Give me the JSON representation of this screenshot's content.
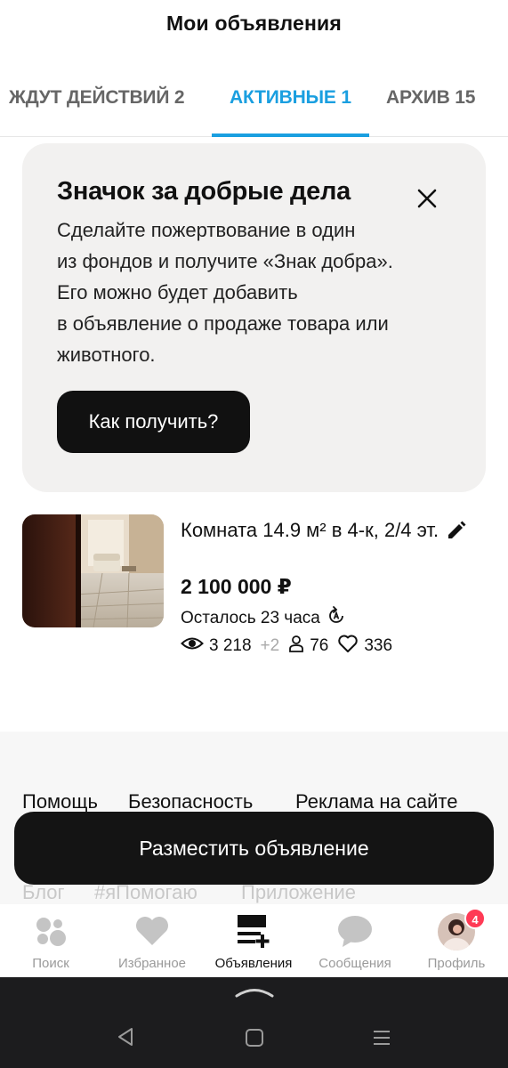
{
  "header": {
    "title": "Мои объявления"
  },
  "tabs": {
    "waiting": "ЖДУТ ДЕЙСТВИЙ 2",
    "active": "АКТИВНЫЕ 1",
    "archive": "АРХИВ 15"
  },
  "promo": {
    "title": "Значок за добрые дела",
    "lines": [
      "Сделайте пожертвование в один",
      "из фондов и получите «Знак добра».",
      "Его можно будет добавить",
      "в объявление о продаже товара или",
      "животного."
    ],
    "button_label": "Как получить?",
    "close_icon": "close-icon"
  },
  "ad": {
    "title": "Комната 14.9 м² в 4-к, 2/4 эт.",
    "price": "2 100 000 ₽",
    "remaining": "Осталось 23 часа",
    "views": "3 218",
    "views_delta": "+2",
    "contacts": "76",
    "favorites": "336"
  },
  "footer": {
    "links_row1": [
      "Помощь",
      "Безопасность",
      "Реклама на сайте"
    ],
    "links_row2": [
      "Блог",
      "#яПомогаю",
      "Приложение"
    ]
  },
  "post_button_label": "Разместить объявление",
  "tabbar": {
    "items": [
      {
        "label": "Поиск",
        "icon": "search-dots-icon"
      },
      {
        "label": "Избранное",
        "icon": "heart-icon"
      },
      {
        "label": "Объявления",
        "icon": "listings-add-icon"
      },
      {
        "label": "Сообщения",
        "icon": "chat-bubble-icon"
      },
      {
        "label": "Профиль",
        "icon": "avatar"
      }
    ],
    "profile_badge": "4"
  },
  "colors": {
    "accent": "#1a9fe0",
    "badge": "#ff3a55",
    "dark_button": "#141414"
  }
}
